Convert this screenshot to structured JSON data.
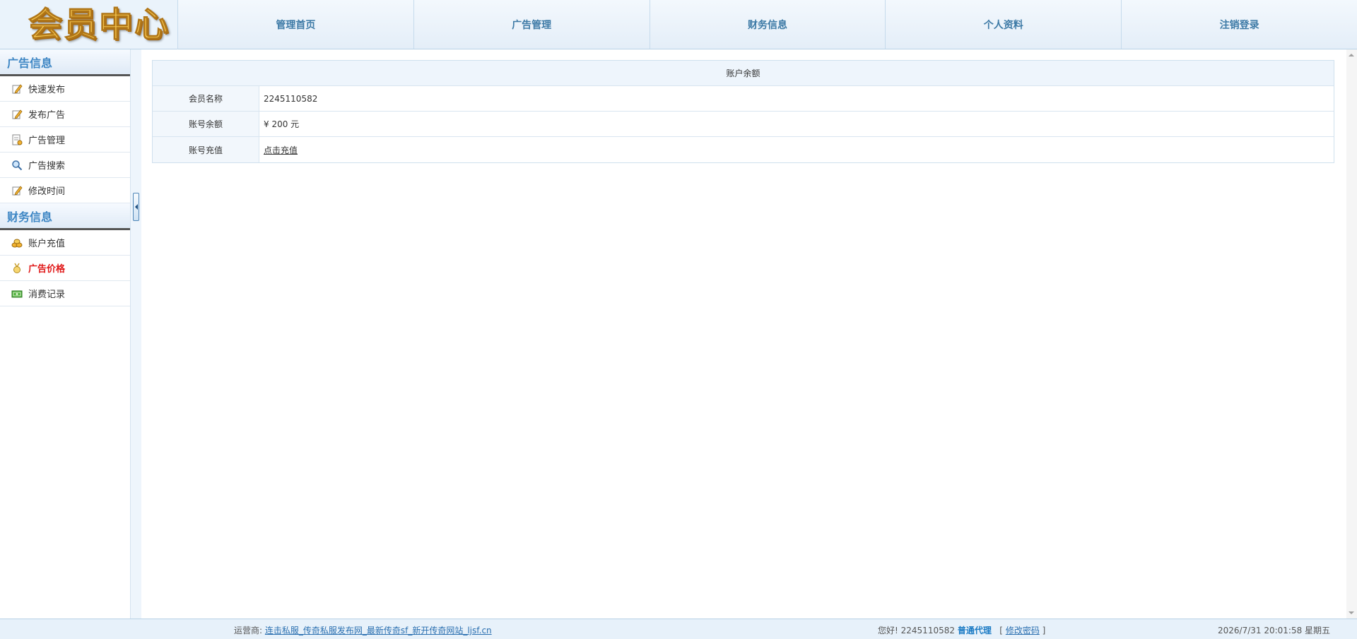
{
  "header": {
    "logo_text": "会员中心",
    "nav": [
      {
        "label": "管理首页"
      },
      {
        "label": "广告管理"
      },
      {
        "label": "财务信息"
      },
      {
        "label": "个人资料"
      },
      {
        "label": "注销登录"
      }
    ]
  },
  "sidebar": {
    "sections": [
      {
        "title": "广告信息",
        "items": [
          {
            "label": "快速发布",
            "icon": "pencil-icon"
          },
          {
            "label": "发布广告",
            "icon": "pencil-icon"
          },
          {
            "label": "广告管理",
            "icon": "document-manage-icon"
          },
          {
            "label": "广告搜索",
            "icon": "magnifier-icon"
          },
          {
            "label": "修改时间",
            "icon": "pencil-icon"
          }
        ]
      },
      {
        "title": "财务信息",
        "items": [
          {
            "label": "账户充值",
            "icon": "coins-icon"
          },
          {
            "label": "广告价格",
            "icon": "medal-icon",
            "active": true
          },
          {
            "label": "消费记录",
            "icon": "money-bill-icon"
          }
        ]
      }
    ]
  },
  "main": {
    "panel_title": "账户余额",
    "rows": [
      {
        "label": "会员名称",
        "value": "2245110582"
      },
      {
        "label": "账号余额",
        "value": "¥ 200 元"
      },
      {
        "label": "账号充值",
        "value": "点击充值",
        "is_link": true
      }
    ]
  },
  "footer": {
    "operator_label": "运营商:",
    "operator_link": "连击私服_传奇私服发布网_最新传奇sf_新开传奇网站_ljsf.cn",
    "greeting": "您好!",
    "username": "2245110582",
    "role": "普通代理",
    "bracket_open": "[",
    "change_password": "修改密码",
    "bracket_close": "]",
    "datetime": "2026/7/31 20:01:58 星期五"
  },
  "colors": {
    "accent": "#3d86c4",
    "active_menu": "#e01818",
    "header_bg": "#eaf3fb"
  }
}
